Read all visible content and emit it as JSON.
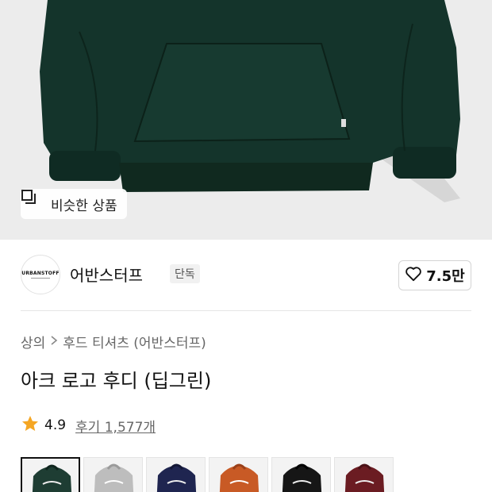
{
  "similar_button": {
    "label": "비슷한 상품",
    "icon": "similar-products-icon"
  },
  "brand": {
    "logo_text": "URBANSTOFF",
    "name": "어반스터프",
    "badge": "단독"
  },
  "like": {
    "icon": "heart-icon",
    "count": "7.5만"
  },
  "breadcrumb": {
    "category": "상의",
    "subcategory": "후드 티셔츠 (어반스터프)"
  },
  "product": {
    "title": "아크 로고 후디 (딥그린)",
    "rating": "4.9",
    "reviews": "후기 1,577개"
  },
  "colors": {
    "star": "#f5a623",
    "hoodie_main": "#14342b",
    "thumb_colors": [
      "#1e3d33",
      "#bdbdbd",
      "#1f2550",
      "#c85a25",
      "#161616",
      "#6b1c22"
    ]
  }
}
